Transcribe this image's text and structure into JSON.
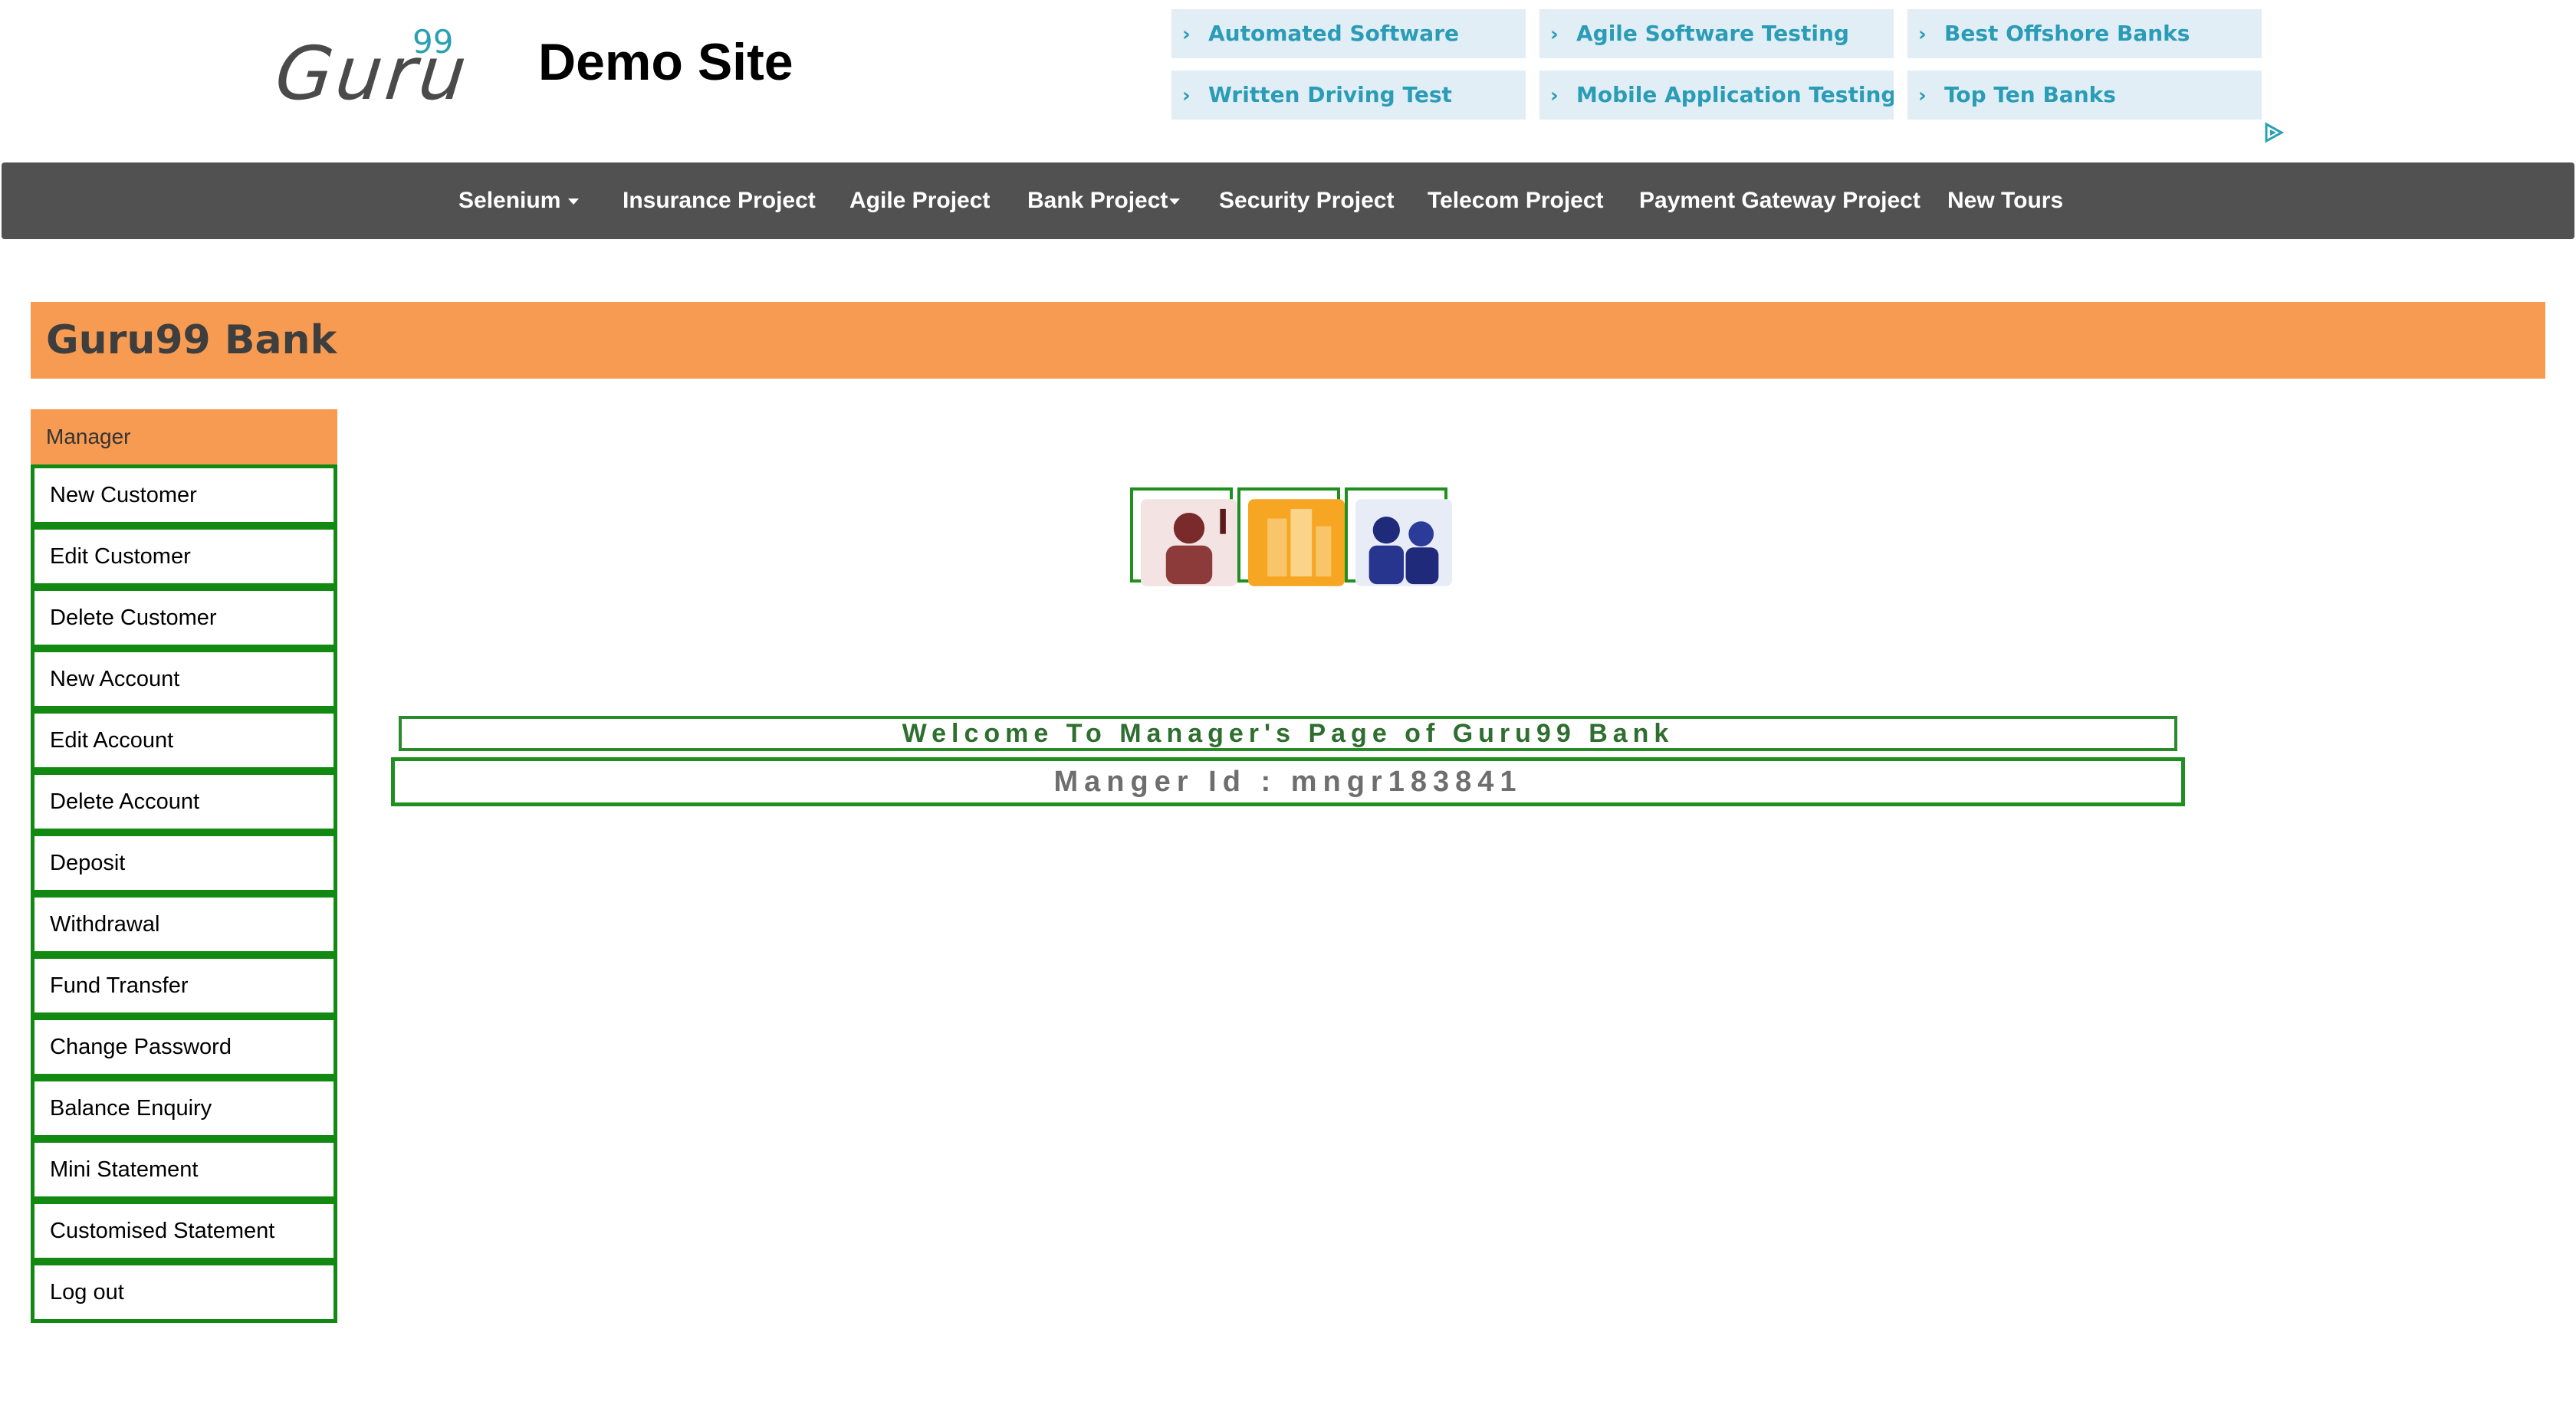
{
  "header": {
    "logo_text": "Guru",
    "logo_sup": "99",
    "site_title": "Demo Site"
  },
  "ads": [
    {
      "label": "Automated Software"
    },
    {
      "label": "Agile Software Testing"
    },
    {
      "label": "Best Offshore Banks"
    },
    {
      "label": "Written Driving Test"
    },
    {
      "label": "Mobile Application Testing"
    },
    {
      "label": "Top Ten Banks"
    }
  ],
  "nav": [
    {
      "label": "Selenium",
      "dropdown": true
    },
    {
      "label": "Insurance Project"
    },
    {
      "label": "Agile Project"
    },
    {
      "label": "Bank Project",
      "dropdown": true
    },
    {
      "label": "Security Project"
    },
    {
      "label": "Telecom Project"
    },
    {
      "label": "Payment Gateway Project"
    },
    {
      "label": "New Tours"
    }
  ],
  "bank_title": "Guru99 Bank",
  "sidebar": {
    "header": "Manager",
    "items": [
      {
        "label": "New Customer"
      },
      {
        "label": "Edit Customer"
      },
      {
        "label": "Delete Customer"
      },
      {
        "label": "New Account"
      },
      {
        "label": "Edit Account"
      },
      {
        "label": "Delete Account"
      },
      {
        "label": "Deposit"
      },
      {
        "label": "Withdrawal"
      },
      {
        "label": "Fund Transfer"
      },
      {
        "label": "Change Password"
      },
      {
        "label": "Balance Enquiry"
      },
      {
        "label": "Mini Statement"
      },
      {
        "label": "Customised Statement"
      },
      {
        "label": "Log out"
      }
    ]
  },
  "main": {
    "welcome": "Welcome To Manager's Page of Guru99 Bank",
    "manager_id": "Manger Id : mngr183841"
  },
  "colors": {
    "orange": "#f79b52",
    "nav_bg": "#515151",
    "green_border": "#128a12",
    "ad_bg": "#e1eef6",
    "ad_text": "#2a9cb6"
  }
}
